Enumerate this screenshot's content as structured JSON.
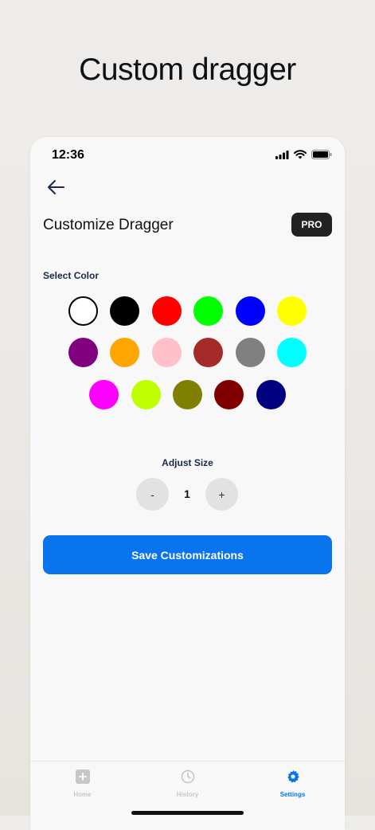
{
  "promo": {
    "headline": "Custom dragger"
  },
  "status_bar": {
    "time": "12:36"
  },
  "header": {
    "title": "Customize Dragger",
    "badge": "PRO"
  },
  "colors": {
    "label": "Select Color",
    "swatches": [
      "#ffffff",
      "#000000",
      "#ff0000",
      "#00ff00",
      "#0000ff",
      "#ffff00",
      "#800080",
      "#ffa500",
      "#ffc0cb",
      "#a52a2a",
      "#808080",
      "#00ffff",
      "#ff00ff",
      "#bfff00",
      "#808000",
      "#800000",
      "#000080"
    ],
    "selected_index": 0
  },
  "size": {
    "label": "Adjust Size",
    "decrement": "-",
    "value": "1",
    "increment": "+"
  },
  "save_button": {
    "label": "Save Customizations"
  },
  "tabbar": {
    "active_color": "#0a74ee",
    "inactive_color": "#c7c7c7",
    "tabs": [
      {
        "label": "Home",
        "icon": "plus-square-icon"
      },
      {
        "label": "History",
        "icon": "clock-icon"
      },
      {
        "label": "Settings",
        "icon": "gear-icon",
        "active": true
      }
    ]
  }
}
